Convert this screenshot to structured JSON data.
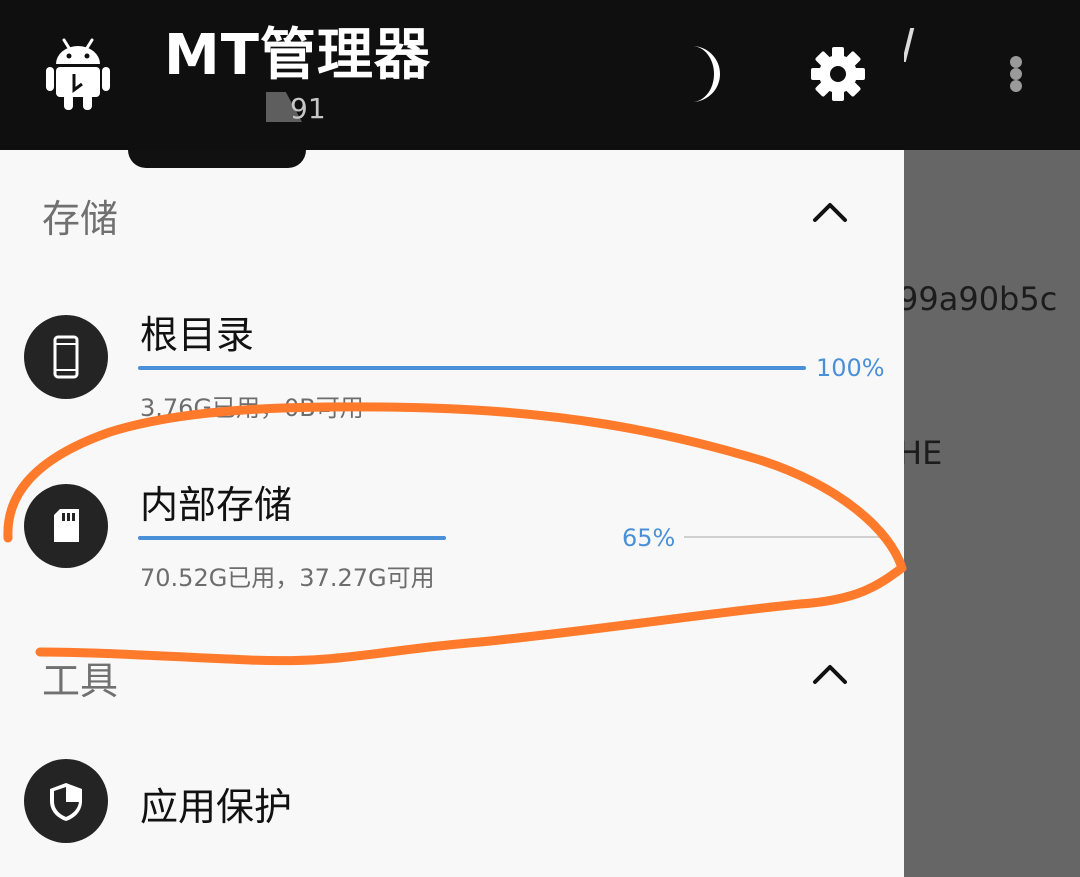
{
  "header": {
    "title": "MT管理器",
    "version": "91",
    "actions": [
      {
        "icon": "moon-icon",
        "label": "night mode"
      },
      {
        "icon": "gear-icon",
        "label": "settings"
      }
    ]
  },
  "sections": {
    "storage": {
      "label": "存储",
      "items": [
        {
          "title": "根目录",
          "percent": 100,
          "percent_label": "100%",
          "usage": "3.76G已用，0B可用",
          "icon": "phone-icon"
        },
        {
          "title": "内部存储",
          "percent": 65,
          "percent_label": "65%",
          "usage": "70.52G已用，37.27G可用",
          "icon": "sd-card-icon"
        }
      ]
    },
    "tools": {
      "label": "工具",
      "items": [
        {
          "title": "应用保护",
          "icon": "shield-icon"
        }
      ]
    }
  },
  "background": {
    "text_1": "99a90b5c",
    "text_2": "HE"
  },
  "colors": {
    "accent": "#4a90d9",
    "header_bg": "#0f0f0f",
    "annotation": "#ff7a2a"
  }
}
